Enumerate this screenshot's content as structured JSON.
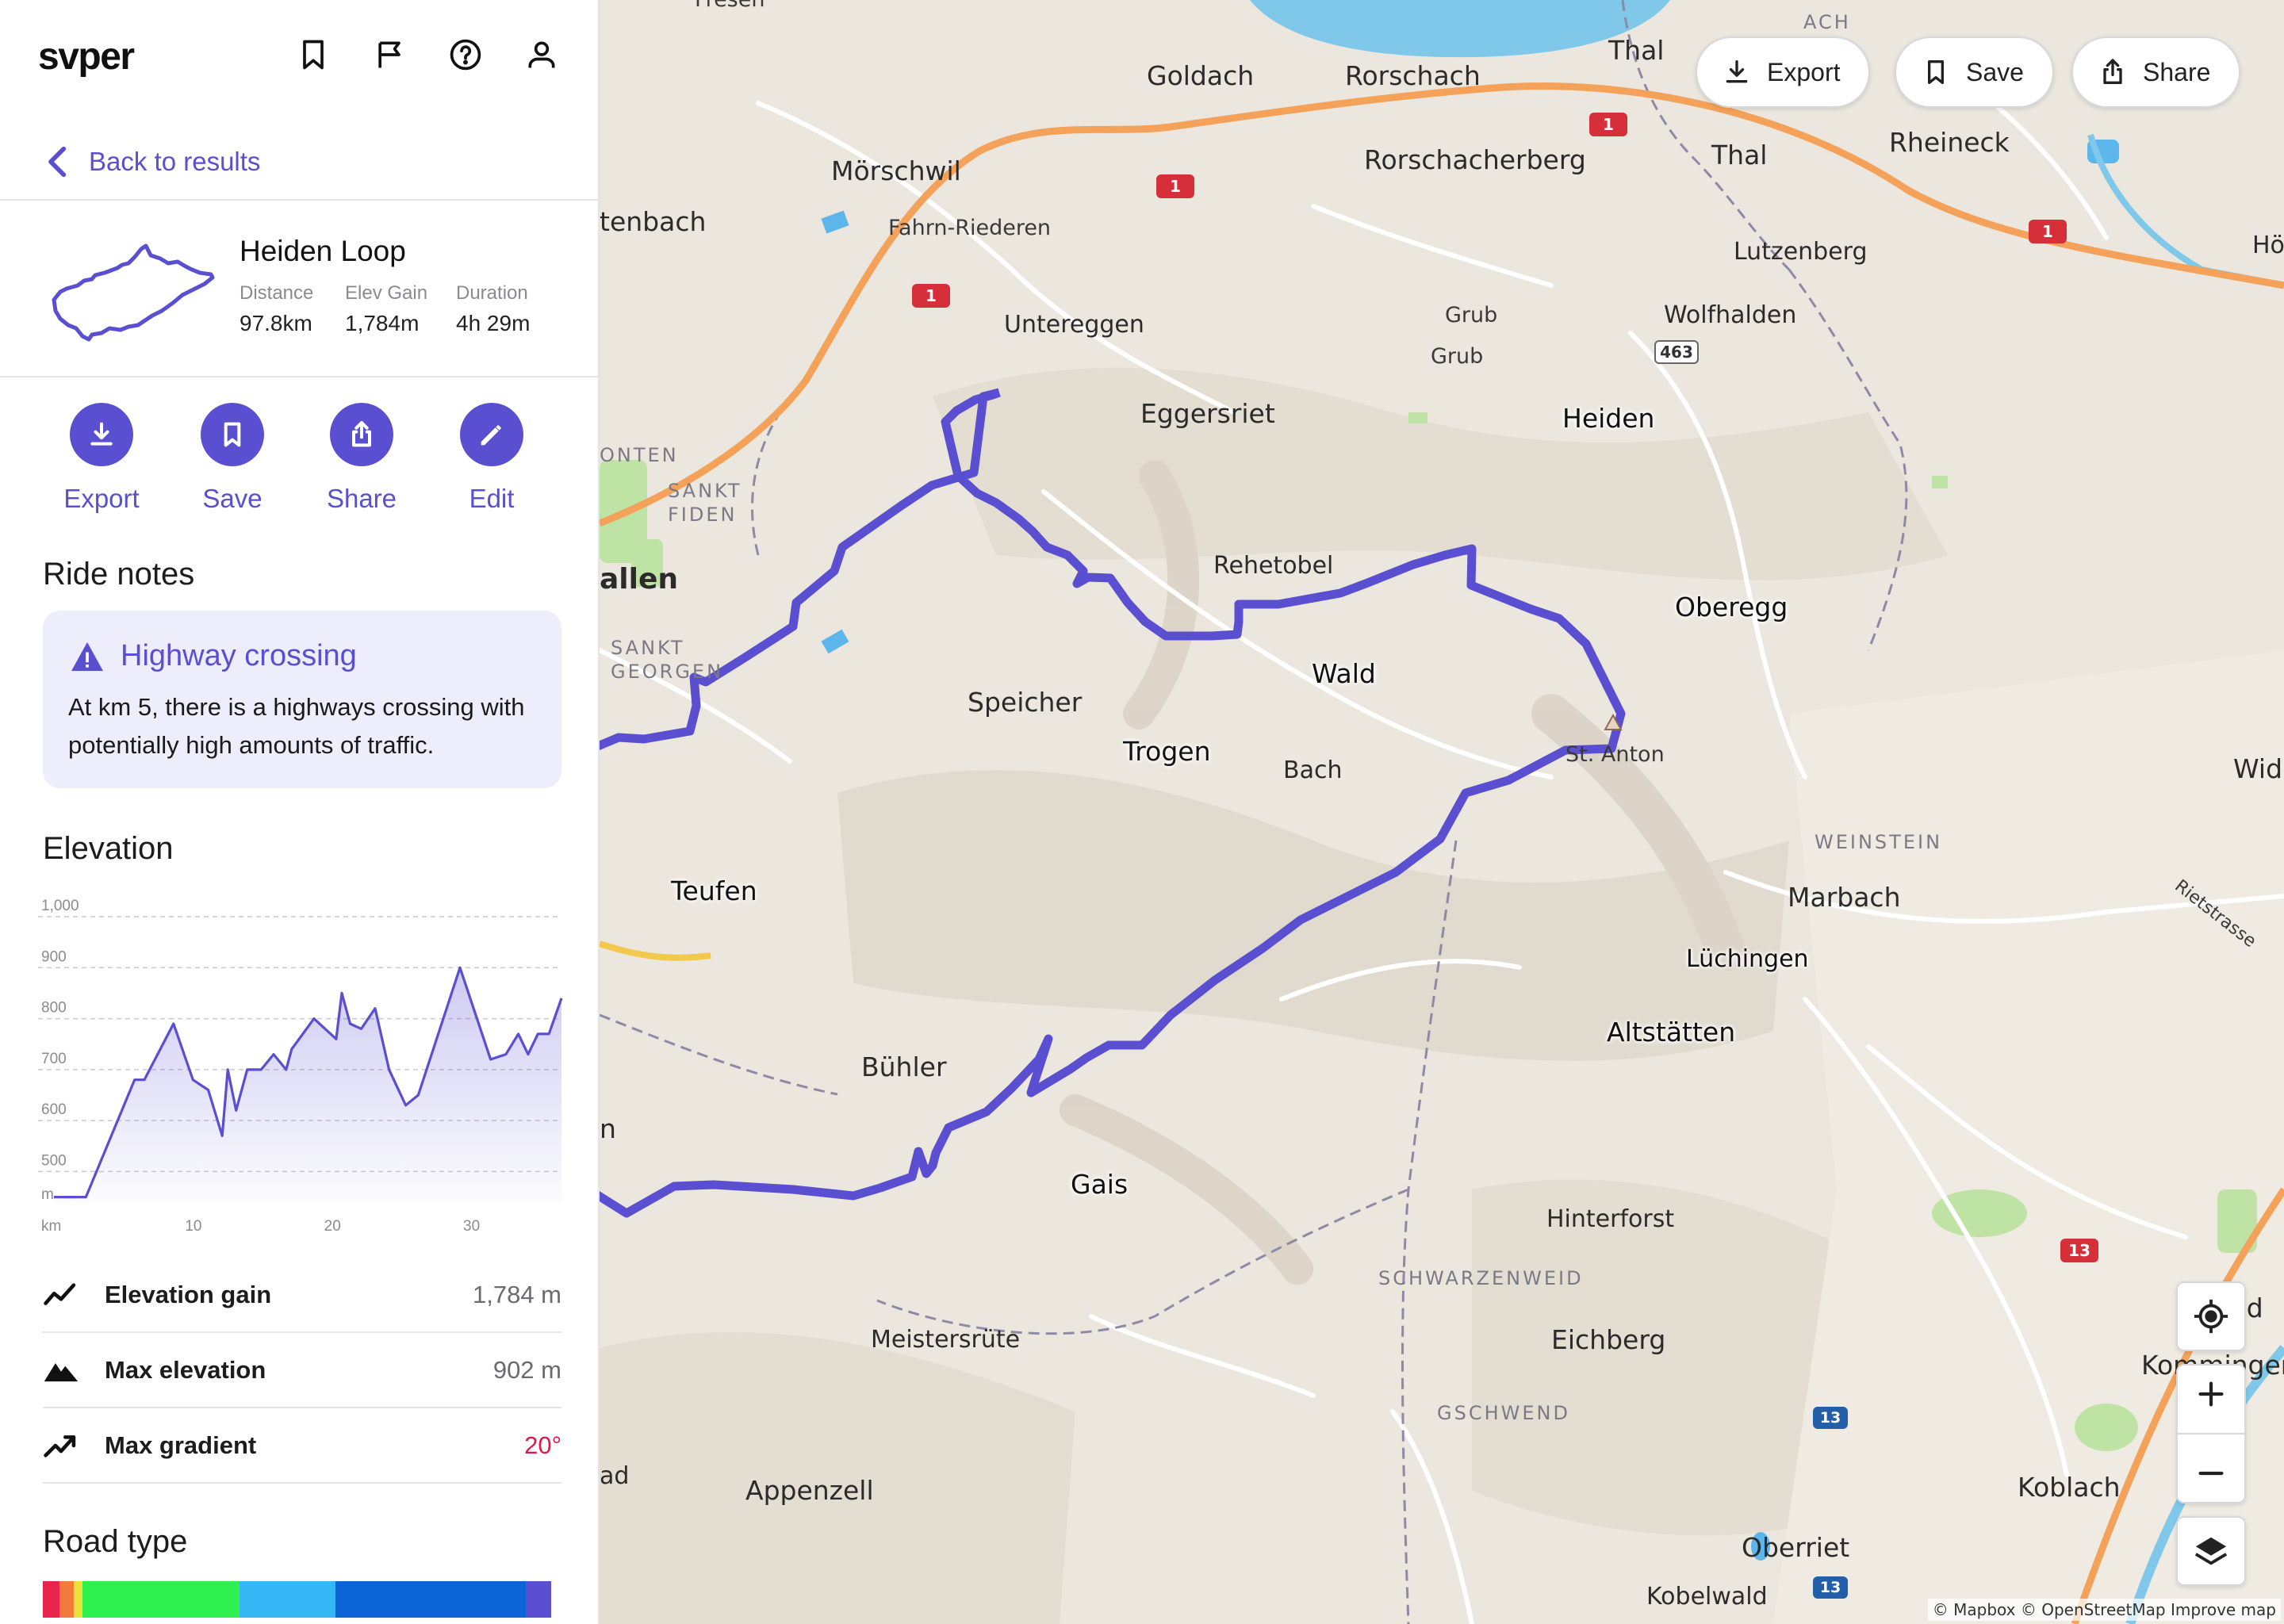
{
  "app": {
    "logo": "svper"
  },
  "nav": {
    "back_label": "Back to results"
  },
  "route": {
    "name": "Heiden Loop",
    "stats": [
      {
        "label": "Distance",
        "value": "97.8km"
      },
      {
        "label": "Elev Gain",
        "value": "1,784m"
      },
      {
        "label": "Duration",
        "value": "4h 29m"
      }
    ]
  },
  "actions": [
    {
      "label": "Export",
      "icon": "download-icon"
    },
    {
      "label": "Save",
      "icon": "bookmark-icon"
    },
    {
      "label": "Share",
      "icon": "share-icon"
    },
    {
      "label": "Edit",
      "icon": "pencil-icon"
    }
  ],
  "notes": {
    "section_title": "Ride notes",
    "title": "Highway crossing",
    "text": "At km 5, there is a highways crossing with potentially high amounts of traffic."
  },
  "elevation": {
    "section_title": "Elevation",
    "y_unit": "m",
    "x_unit": "km",
    "y_ticks": [
      "1,000",
      "900",
      "800",
      "700",
      "600",
      "500"
    ],
    "x_ticks": [
      "10",
      "20",
      "30"
    ]
  },
  "chart_data": {
    "type": "area",
    "title": "Elevation",
    "xlabel": "km",
    "ylabel": "m",
    "ylim": [
      440,
      1000
    ],
    "xlim": [
      0,
      36.5
    ],
    "x": [
      0,
      2.3,
      5.8,
      6.5,
      8.6,
      10,
      11.1,
      12.1,
      12.5,
      13.1,
      13.9,
      14.9,
      15.8,
      16.7,
      17.1,
      18.7,
      20.3,
      20.7,
      21.3,
      22.1,
      23.1,
      24.1,
      25.3,
      26.2,
      29.2,
      31.4,
      32.5,
      33.4,
      34.1,
      34.8,
      35.6,
      36.5
    ],
    "series": [
      {
        "values": [
          450,
          450,
          680,
          680,
          790,
          680,
          660,
          570,
          700,
          620,
          700,
          700,
          730,
          700,
          740,
          800,
          760,
          850,
          790,
          780,
          820,
          700,
          630,
          650,
          900,
          720,
          730,
          770,
          730,
          770,
          770,
          840
        ]
      }
    ]
  },
  "summary": [
    {
      "label": "Elevation gain",
      "value": "1,784 m",
      "icon": "trend-up-icon",
      "color": "#6a6a70"
    },
    {
      "label": "Max elevation",
      "value": "902 m",
      "icon": "mountain-icon",
      "color": "#6a6a70"
    },
    {
      "label": "Max gradient",
      "value": "20°",
      "icon": "gradient-icon",
      "color": "#e0174b"
    }
  ],
  "road_type": {
    "section_title": "Road type",
    "segments": [
      {
        "fraction": 0.032,
        "color": "#e8234c"
      },
      {
        "fraction": 0.028,
        "color": "#f27a3a"
      },
      {
        "fraction": 0.016,
        "color": "#e8e23a"
      },
      {
        "fraction": 0.304,
        "color": "#2ef04f"
      },
      {
        "fraction": 0.185,
        "color": "#35b6f5"
      },
      {
        "fraction": 0.367,
        "color": "#0b63d6"
      },
      {
        "fraction": 0.048,
        "color": "#5a4fd1"
      }
    ]
  },
  "map": {
    "buttons": {
      "export": "Export",
      "save": "Save",
      "share": "Share"
    },
    "attribution": "© Mapbox © OpenStreetMap Improve map",
    "route_color": "#5a4fd1",
    "places": {
      "fresen": "Fresen",
      "ach": "ACH",
      "goldach": "Goldach",
      "rorschach": "Rorschach",
      "thal": "Thal",
      "thal2": "Thal",
      "rorschacherberg": "Rorschacherberg",
      "rheineck": "Rheineck",
      "morschwil": "Mörschwil",
      "fahrn": "Fahrn-Riederen",
      "tenbach": "tenbach",
      "lutzenberg": "Lutzenberg",
      "wolfhalden": "Wolfhalden",
      "ho": "Hö",
      "untereggen": "Untereggen",
      "grub1": "Grub",
      "grub2": "Grub",
      "eggersriet": "Eggersriet",
      "heiden": "Heiden",
      "onten": "ONTEN",
      "sankt_fiden": "SANKT\nFIDEN",
      "allen": "allen",
      "rehetobel": "Rehetobel",
      "oberegg": "Oberegg",
      "sankt_georgen": "SANKT\nGEORGEN",
      "speicher": "Speicher",
      "wald": "Wald",
      "trogen": "Trogen",
      "bach": "Bach",
      "st_anton": "St. Anton",
      "widn": "Widn",
      "weinstein": "WEINSTEIN",
      "teufen": "Teufen",
      "marbach": "Marbach",
      "rietstrasse": "Rietstrasse",
      "luchingen": "Lüchingen",
      "altstatten": "Altstätten",
      "buhler": "Bühler",
      "n": "n",
      "gais": "Gais",
      "hinterforst": "Hinterforst",
      "schwarzenweid": "SCHWARZENWEID",
      "meistersrute": "Meistersrüte",
      "eichberg": "Eichberg",
      "mad": "Mäd",
      "kommingen": "Kommingen",
      "gschwend": "GSCHWEND",
      "ad": "ad",
      "appenzell": "Appenzell",
      "koblach": "Koblach",
      "oberriet": "Oberriet",
      "kobelwald": "Kobelwald"
    },
    "shields": {
      "a1": "1",
      "r463": "463",
      "r13": "13"
    }
  }
}
